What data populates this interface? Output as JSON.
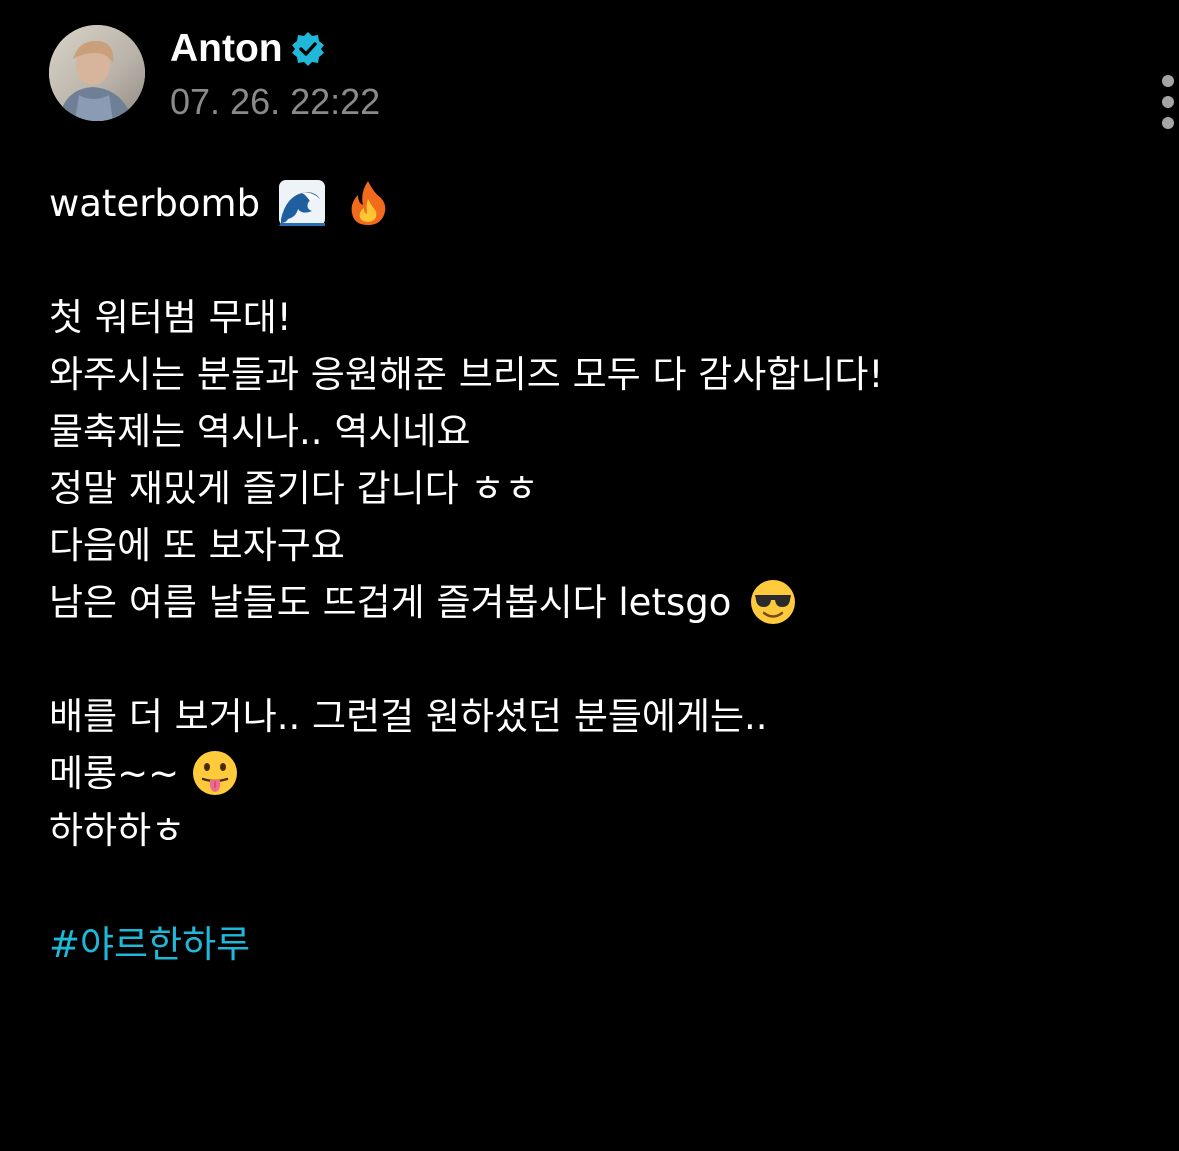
{
  "author": {
    "name": "Anton",
    "timestamp": "07. 26. 22:22"
  },
  "icons": {
    "verified": "verified-badge-icon",
    "more": "more-vertical-icon",
    "wave": "water-wave-emoji",
    "fire": "fire-emoji",
    "sunglasses": "sunglasses-face-emoji",
    "tongue": "tongue-out-face-emoji"
  },
  "colors": {
    "background": "#000000",
    "text": "#ffffff",
    "timestamp": "#8a8a8a",
    "verified": "#1fb8d9",
    "hashtag": "#1fb8d9"
  },
  "post": {
    "title_line": "waterbomb",
    "lines": [
      "첫 워터범 무대!",
      "와주시는 분들과 응원해준 브리즈 모두 다 감사합니다!",
      "물축제는 역시나.. 역시네요",
      "정말 재밌게 즐기다 갑니다 ㅎㅎ",
      "다음에 또 보자구요",
      "남은 여름 날들도 뜨겁게 즐겨봅시다 letsgo"
    ],
    "lines2": [
      "배를 더 보거나.. 그런걸 원하셨던 분들에게는..",
      "메롱~~",
      "하하하ㅎ"
    ],
    "hashtag": "#야르한하루"
  }
}
